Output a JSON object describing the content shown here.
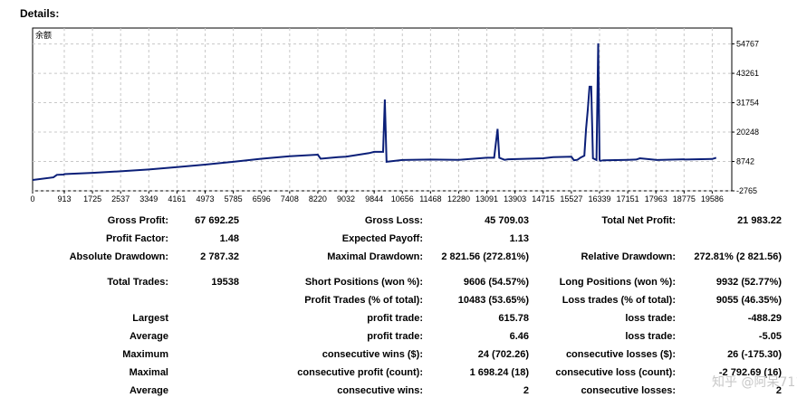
{
  "heading": "Details:",
  "chart_data": {
    "type": "line",
    "title": "余额",
    "series": [
      {
        "color": "#0b1f78",
        "x": [
          0,
          600,
          700,
          900,
          913,
          1725,
          2537,
          3349,
          4161,
          4973,
          5785,
          6596,
          7408,
          8220,
          8300,
          8800,
          9032,
          9700,
          9844,
          10100,
          10150,
          10200,
          10656,
          11468,
          12280,
          13091,
          13300,
          13400,
          13450,
          13600,
          13700,
          14715,
          15000,
          15527,
          15600,
          15700,
          15800,
          15900,
          15950,
          16000,
          16050,
          16100,
          16150,
          16250,
          16300,
          16339,
          16360,
          16450,
          17151,
          17400,
          17500,
          17963,
          18000,
          18775,
          18800,
          19586,
          19700
        ],
        "y": [
          1500,
          2500,
          3500,
          3600,
          3800,
          4300,
          4900,
          5600,
          6500,
          7500,
          8600,
          9800,
          10800,
          11400,
          9800,
          10400,
          10600,
          12000,
          12500,
          12500,
          33000,
          8600,
          9300,
          9500,
          9400,
          10200,
          10200,
          21500,
          10200,
          9400,
          9600,
          10000,
          10400,
          10600,
          9200,
          9400,
          10300,
          11000,
          21500,
          29000,
          38000,
          38000,
          10000,
          9300,
          55000,
          9300,
          9000,
          9200,
          9400,
          9500,
          10000,
          9400,
          9300,
          9600,
          9500,
          9700,
          10200
        ]
      }
    ],
    "x_ticks": [
      0,
      913,
      1725,
      2537,
      3349,
      4161,
      4973,
      5785,
      6596,
      7408,
      8220,
      9032,
      9844,
      10656,
      11468,
      12280,
      13091,
      13903,
      14715,
      15527,
      16339,
      17151,
      17963,
      18775,
      19586
    ],
    "y_ticks": [
      54767,
      43261,
      31754,
      20248,
      8742,
      -2765
    ],
    "xlim": [
      0,
      20150
    ],
    "ylim": [
      -2765,
      61000
    ],
    "grid": true
  },
  "stats": {
    "gross_profit_label": "Gross Profit:",
    "gross_profit": "67 692.25",
    "gross_loss_label": "Gross Loss:",
    "gross_loss": "45 709.03",
    "net_profit_label": "Total Net Profit:",
    "net_profit": "21 983.22",
    "profit_factor_label": "Profit Factor:",
    "profit_factor": "1.48",
    "expected_payoff_label": "Expected Payoff:",
    "expected_payoff": "1.13",
    "abs_dd_label": "Absolute Drawdown:",
    "abs_dd": "2 787.32",
    "max_dd_label": "Maximal Drawdown:",
    "max_dd": "2 821.56 (272.81%)",
    "rel_dd_label": "Relative Drawdown:",
    "rel_dd": "272.81% (2 821.56)",
    "total_trades_label": "Total Trades:",
    "total_trades": "19538",
    "short_label": "Short Positions (won %):",
    "short": "9606 (54.57%)",
    "long_label": "Long Positions (won %):",
    "long": "9932 (52.77%)",
    "profit_trades_label": "Profit Trades (% of total):",
    "profit_trades": "10483 (53.65%)",
    "loss_trades_label": "Loss trades (% of total):",
    "loss_trades": "9055 (46.35%)",
    "largest_label": "Largest",
    "largest_profit_label": "profit trade:",
    "largest_profit": "615.78",
    "largest_loss_label": "loss trade:",
    "largest_loss": "-488.29",
    "average_label": "Average",
    "average_profit_label": "profit trade:",
    "average_profit": "6.46",
    "average_loss_label": "loss trade:",
    "average_loss": "-5.05",
    "maximum_label": "Maximum",
    "max_cons_wins_label": "consecutive wins ($):",
    "max_cons_wins": "24 (702.26)",
    "max_cons_losses_label": "consecutive losses ($):",
    "max_cons_losses": "26 (-175.30)",
    "maximal_label": "Maximal",
    "maximal_cons_profit_label": "consecutive profit (count):",
    "maximal_cons_profit": "1 698.24 (18)",
    "maximal_cons_loss_label": "consecutive loss (count):",
    "maximal_cons_loss": "-2 792.69 (16)",
    "average2_label": "Average",
    "avg_cons_wins_label": "consecutive wins:",
    "avg_cons_wins": "2",
    "avg_cons_losses_label": "consecutive losses:",
    "avg_cons_losses": "2"
  },
  "watermark": "知乎 @阿呆711"
}
